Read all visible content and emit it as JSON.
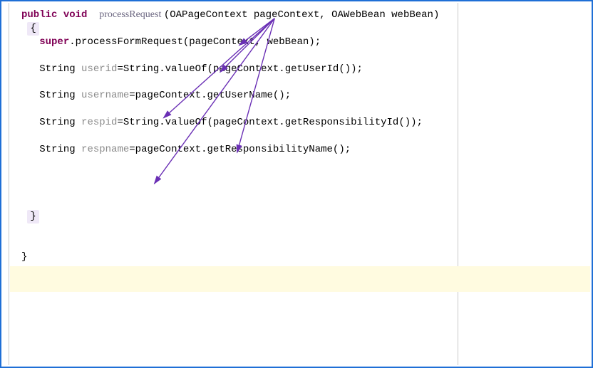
{
  "code": {
    "sig": {
      "kw_public": "public",
      "kw_void": "void",
      "method": "processRequest",
      "params_open": "(",
      "param1_type": "OAPageContext",
      "param1_name": "pageContext",
      "comma": ",",
      "param2_type": "OAWebBean",
      "param2_name": "webBean",
      "params_close": ")"
    },
    "open_brace": "{",
    "super_line": {
      "kw_super": "super",
      "rest": ".processFormRequest(pageContext, webBean);"
    },
    "line_userid": {
      "type": "String",
      "var": "userid",
      "rest": "=String.valueOf(pageContext.getUserId());"
    },
    "line_username": {
      "type": "String",
      "var": "username",
      "rest": "=pageContext.getUserName();"
    },
    "line_respid": {
      "type": "String",
      "var": "respid",
      "rest": "=String.valueOf(pageContext.getResponsibilityId());"
    },
    "line_respname": {
      "type": "String",
      "var": "respname",
      "rest": "=pageContext.getResponsibilityName();"
    },
    "close_brace_inner": "}",
    "close_brace_outer": "}"
  },
  "annotations": {
    "origin": "pageContext parameter",
    "targets": [
      "super call pageContext",
      "userid pageContext",
      "username pageContext",
      "respid pageContext",
      "respname pageContext"
    ]
  }
}
